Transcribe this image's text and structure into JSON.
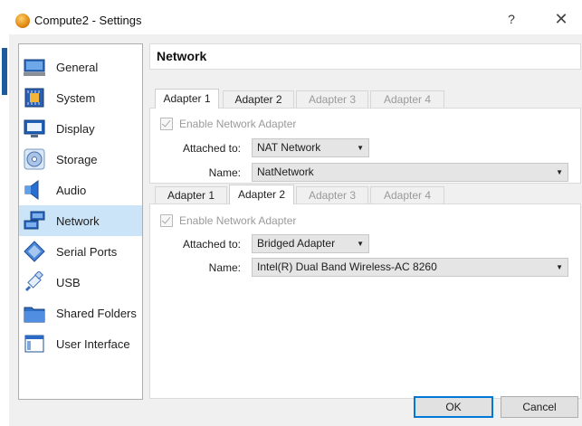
{
  "window": {
    "title": "Compute2 - Settings",
    "help_label": "?",
    "close_label": "✕"
  },
  "sidebar": {
    "items": [
      {
        "label": "General",
        "icon": "general-icon",
        "selected": false
      },
      {
        "label": "System",
        "icon": "system-chip-icon",
        "selected": false
      },
      {
        "label": "Display",
        "icon": "monitor-icon",
        "selected": false
      },
      {
        "label": "Storage",
        "icon": "disc-icon",
        "selected": false
      },
      {
        "label": "Audio",
        "icon": "speaker-icon",
        "selected": false
      },
      {
        "label": "Network",
        "icon": "network-icon",
        "selected": true
      },
      {
        "label": "Serial Ports",
        "icon": "serial-port-icon",
        "selected": false
      },
      {
        "label": "USB",
        "icon": "usb-icon",
        "selected": false
      },
      {
        "label": "Shared Folders",
        "icon": "folder-icon",
        "selected": false
      },
      {
        "label": "User Interface",
        "icon": "window-icon",
        "selected": false
      }
    ]
  },
  "section": {
    "title": "Network"
  },
  "panels": [
    {
      "tabs": [
        "Adapter 1",
        "Adapter 2",
        "Adapter 3",
        "Adapter 4"
      ],
      "active_tab": 0,
      "enable_label": "Enable Network Adapter",
      "enable_checked": true,
      "attached_label": "Attached to:",
      "attached_value": "NAT Network",
      "name_label": "Name:",
      "name_value": "NatNetwork"
    },
    {
      "tabs": [
        "Adapter 1",
        "Adapter 2",
        "Adapter 3",
        "Adapter 4"
      ],
      "active_tab": 1,
      "enable_label": "Enable Network Adapter",
      "enable_checked": true,
      "attached_label": "Attached to:",
      "attached_value": "Bridged Adapter",
      "name_label": "Name:",
      "name_value": "Intel(R) Dual Band Wireless-AC 8260"
    }
  ],
  "buttons": {
    "ok": "OK",
    "cancel": "Cancel"
  },
  "colors": {
    "selection": "#cce4f7",
    "default_button_border": "#0078d7"
  }
}
